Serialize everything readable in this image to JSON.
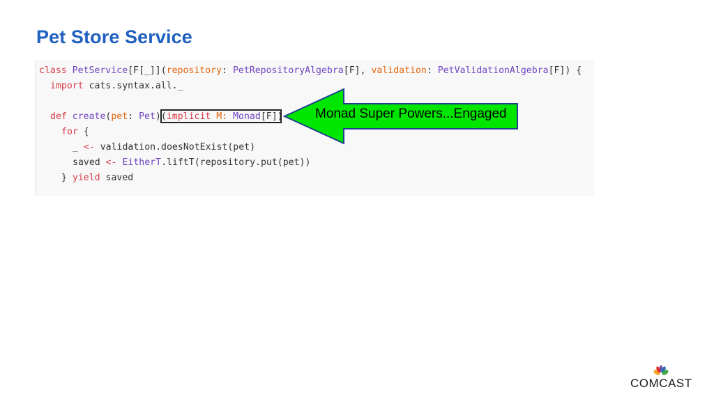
{
  "slide": {
    "title": "Pet Store Service"
  },
  "code": {
    "line1": {
      "kw_class": "class",
      "class_name": "PetService",
      "type_params": "[F[_]]",
      "paren_open": "(",
      "param_repository": "repository",
      "colon1": ": ",
      "type_repo": "PetRepositoryAlgebra",
      "type_repo_f": "[F]",
      "comma": ", ",
      "param_validation": "validation",
      "colon2": ": ",
      "type_validation": "PetValidationAlgebra",
      "type_validation_f": "[F]",
      "close": ") {"
    },
    "line2": {
      "kw_import": "import",
      "import_path": " cats.syntax.all._"
    },
    "line4": {
      "kw_def": "def",
      "method_name": " create",
      "paren_open": "(",
      "param_pet": "pet",
      "colon": ": ",
      "type_pet": "Pet",
      "close_paren": ")",
      "implicit_open": "(",
      "kw_implicit": "implicit",
      "implicit_name": " M: ",
      "type_monad": "Monad",
      "type_monad_f": "[F]",
      "implicit_close": ")",
      "brace": " ="
    },
    "line5": {
      "kw_for": "for",
      "brace": " {"
    },
    "line6": {
      "underscore": "_ ",
      "arrow": "<-",
      "expr": " validation.doesNotExist(pet)"
    },
    "line7": {
      "var_saved": "saved ",
      "arrow": "<-",
      "type_eithert": " EitherT",
      "expr": ".liftT(repository.put(pet))"
    },
    "line8": {
      "close_brace": "} ",
      "kw_yield": "yield",
      "result": " saved"
    }
  },
  "callout": {
    "text": "Monad Super Powers...Engaged",
    "arrow_color": "#00e600",
    "arrow_stroke": "#1f3f8f"
  },
  "logo": {
    "text": "COMCAST"
  }
}
